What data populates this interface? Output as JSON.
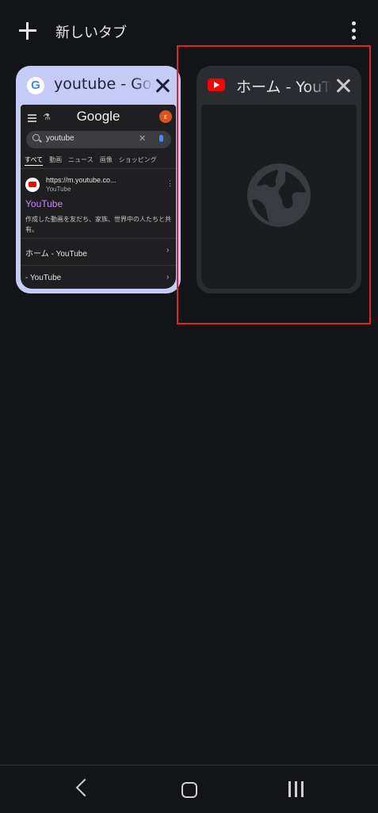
{
  "toolbar": {
    "new_tab_label": "新しいタブ",
    "plus_icon": "plus-icon",
    "more_icon": "more-vert-icon"
  },
  "tabs": [
    {
      "title": "youtube - Google",
      "favicon": "google-icon",
      "favicon_letter": "G",
      "preview": {
        "logo": "Google",
        "avatar_letter": "ε",
        "search_query": "youtube",
        "filter_tabs": [
          "すべて",
          "動画",
          "ニュース",
          "画像",
          "ショッピング"
        ],
        "result_url": "https://m.youtube.co...",
        "result_site": "YouTube",
        "result_title": "YouTube",
        "result_snippet": "作成した動画を友だち、家族、世界中の人たちと共有。",
        "sub_links": [
          "ホーム - YouTube",
          "- YouTube"
        ]
      }
    },
    {
      "title": "ホーム - YouTube",
      "favicon": "youtube-icon",
      "preview_icon": "globe-icon"
    }
  ],
  "colors": {
    "background": "#131417",
    "active_tab_card": "#c5cbf5",
    "inactive_tab_card": "#2b2c31",
    "highlight_box": "#e0242a"
  },
  "navigation": {
    "back_icon": "back-icon",
    "home_icon": "home-icon",
    "recents_icon": "recents-icon"
  }
}
